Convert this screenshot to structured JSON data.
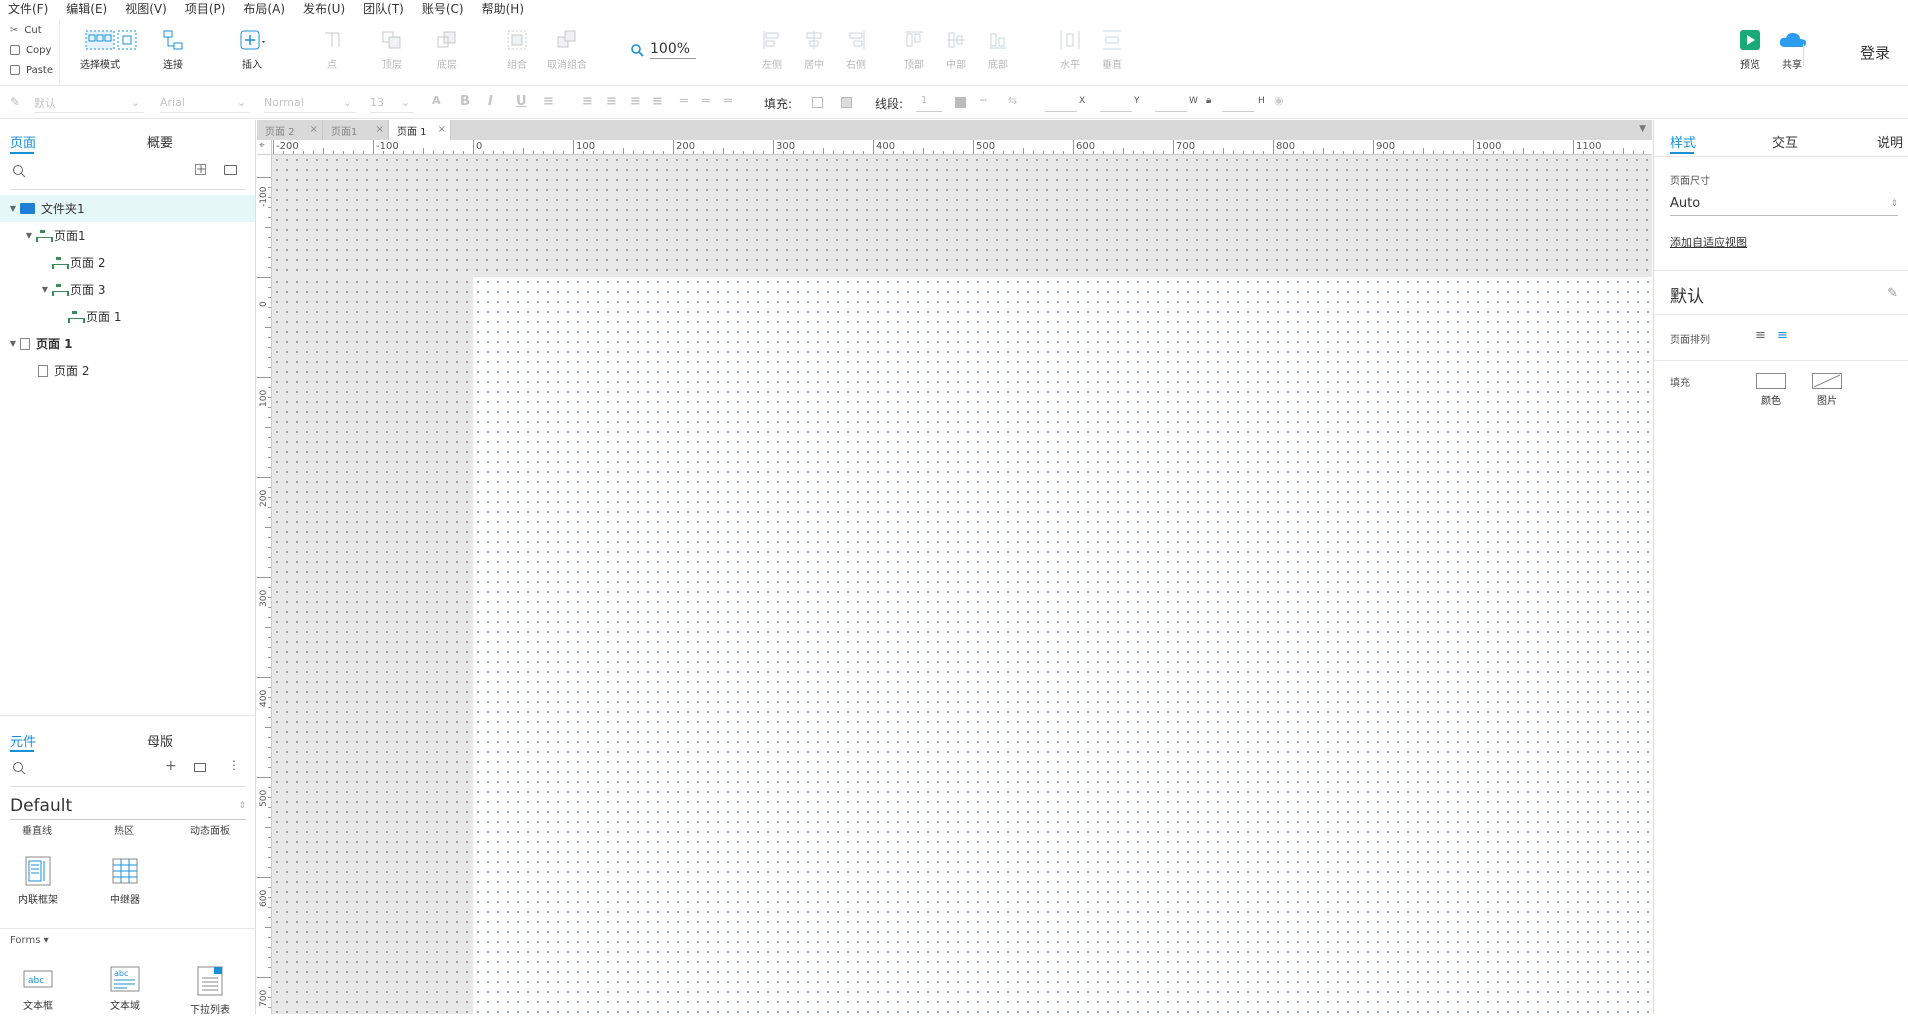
{
  "menu": [
    "文件(F)",
    "编辑(E)",
    "视图(V)",
    "项目(P)",
    "布局(A)",
    "发布(U)",
    "团队(T)",
    "账号(C)",
    "帮助(H)"
  ],
  "clipboard": {
    "cut": "Cut",
    "copy": "Copy",
    "paste": "Paste"
  },
  "toolbar": {
    "select_mode": "选择模式",
    "connect": "连接",
    "insert": "插入",
    "point": "点",
    "top": "顶层",
    "bottom": "底层",
    "group": "组合",
    "ungroup": "取消组合",
    "zoom": "100%",
    "align_left": "左侧",
    "align_center": "居中",
    "align_right": "右侧",
    "align_top": "顶部",
    "align_middle": "中部",
    "align_bottom": "底部",
    "distribute_h": "水平",
    "distribute_v": "垂直",
    "preview": "预览",
    "share": "共享",
    "login": "登录"
  },
  "format": {
    "style": "默认",
    "font": "Arial",
    "weight": "Normal",
    "size": "13",
    "fill_label": "填充:",
    "stroke_label": "线段:",
    "stroke_value": "1",
    "x_label": "X",
    "y_label": "Y",
    "w_label": "W",
    "h_label": "H"
  },
  "left": {
    "tab_pages": "页面",
    "tab_outline": "概要",
    "tree": [
      {
        "label": "文件夹1",
        "type": "folder",
        "depth": 0,
        "expanded": true,
        "selected": true
      },
      {
        "label": "页面1",
        "type": "flow",
        "depth": 1,
        "expanded": true
      },
      {
        "label": "页面 2",
        "type": "flow",
        "depth": 2
      },
      {
        "label": "页面 3",
        "type": "flow",
        "depth": 2,
        "expanded": true
      },
      {
        "label": "页面 1",
        "type": "flow",
        "depth": 3
      },
      {
        "label": "页面 1",
        "type": "page",
        "depth": 0,
        "expanded": true,
        "bold": true
      },
      {
        "label": "页面 2",
        "type": "page",
        "depth": 1
      }
    ],
    "tab_widgets": "元件",
    "tab_masters": "母版",
    "library": "Default",
    "cut_labels": [
      "垂直线",
      "热区",
      "动态面板"
    ],
    "widgets_row1": [
      {
        "label": "内联框架",
        "icon": "inline-frame-icon"
      },
      {
        "label": "中继器",
        "icon": "repeater-icon"
      }
    ],
    "forms_header": "Forms ▾",
    "widgets_forms": [
      {
        "label": "文本框",
        "icon": "text-field-icon"
      },
      {
        "label": "文本域",
        "icon": "text-area-icon"
      },
      {
        "label": "下拉列表",
        "icon": "dropdown-list-icon"
      }
    ]
  },
  "canvas": {
    "tabs": [
      {
        "label": "页面 2",
        "active": false
      },
      {
        "label": "页面1",
        "active": false
      },
      {
        "label": "页面 1",
        "active": true
      }
    ],
    "h_ticks": [
      "-200",
      "-100",
      "0",
      "100",
      "200",
      "300",
      "400",
      "500",
      "600",
      "700",
      "800",
      "900",
      "1000",
      "1100"
    ],
    "v_ticks": [
      "-100",
      "0",
      "100",
      "200",
      "300",
      "400",
      "500",
      "600",
      "700"
    ]
  },
  "right": {
    "tab_style": "样式",
    "tab_interact": "交互",
    "tab_notes": "说明",
    "page_size_label": "页面尺寸",
    "page_size_value": "Auto",
    "adaptive_link": "添加自适应视图",
    "style_name": "默认",
    "page_align_label": "页面排列",
    "fill_label": "填充",
    "fill_color": "颜色",
    "fill_image": "图片"
  },
  "colors": {
    "accent": "#1890d8",
    "preview_green": "#1aa979",
    "share_blue": "#2b9cf0"
  }
}
